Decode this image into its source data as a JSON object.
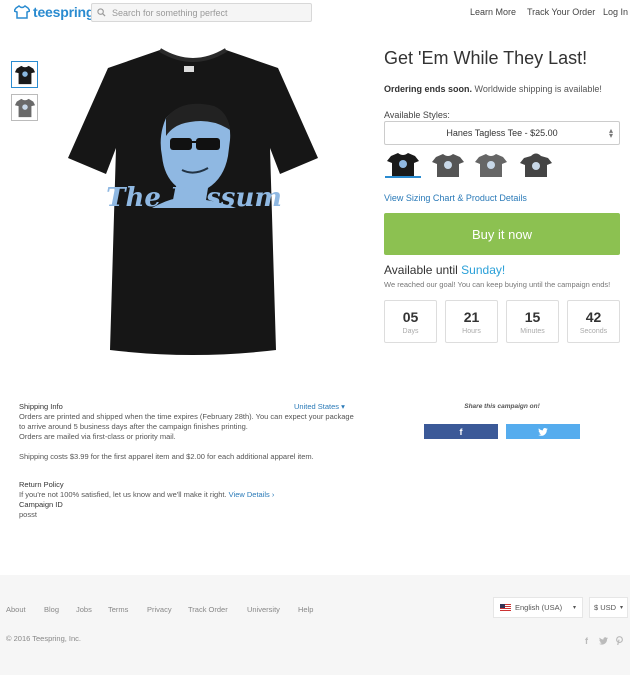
{
  "header": {
    "logo_text": "teespring",
    "search_placeholder": "Search for something perfect",
    "nav": [
      "Learn More",
      "Track Your Order",
      "Log In"
    ]
  },
  "product": {
    "shirt_text": "The Possum",
    "title": "Get 'Em While They Last!",
    "ordering_bold": "Ordering ends soon.",
    "ordering_rest": "Worldwide shipping is available!",
    "styles_label": "Available Styles:",
    "selected_style": "Hanes Tagless Tee - $25.00",
    "style_swatches": [
      {
        "name": "Hanes Tagless Tee",
        "color": "#1a1a1a"
      },
      {
        "name": "Tee",
        "color": "#555555"
      },
      {
        "name": "Tee",
        "color": "#666666"
      },
      {
        "name": "Hoodie",
        "color": "#444444"
      }
    ],
    "sizing_link": "View Sizing Chart & Product Details",
    "buy_label": "Buy it now",
    "available_prefix": "Available until",
    "available_day": "Sunday!",
    "goal_text": "We reached our goal! You can keep buying until the campaign ends!",
    "countdown": [
      {
        "value": "05",
        "unit": "Days"
      },
      {
        "value": "21",
        "unit": "Hours"
      },
      {
        "value": "15",
        "unit": "Minutes"
      },
      {
        "value": "42",
        "unit": "Seconds"
      }
    ],
    "accent_color": "#8cc151",
    "link_color": "#2a7ab8"
  },
  "shipping": {
    "heading": "Shipping Info",
    "country": "United States",
    "line1": "Orders are printed and shipped when the time expires (February 28th). You can expect your package to arrive around 5 business days after the campaign finishes printing.",
    "line2": "Orders are mailed via first-class or priority mail.",
    "costs": "Shipping costs $3.99 for the first apparel item and $2.00 for each additional apparel item.",
    "return_heading": "Return Policy",
    "return_text": "If you're not 100% satisfied, let us know and we'll make it right.",
    "return_link": "View Details",
    "campaign_heading": "Campaign ID",
    "campaign_id": "posst"
  },
  "share": {
    "label": "Share this campaign on!",
    "facebook": "f"
  },
  "footer": {
    "links": [
      "About",
      "Blog",
      "Jobs",
      "Terms",
      "Privacy",
      "Track Order",
      "University",
      "Help"
    ],
    "language": "English (USA)",
    "currency": "$ USD",
    "copyright": "© 2016 Teespring, Inc."
  }
}
